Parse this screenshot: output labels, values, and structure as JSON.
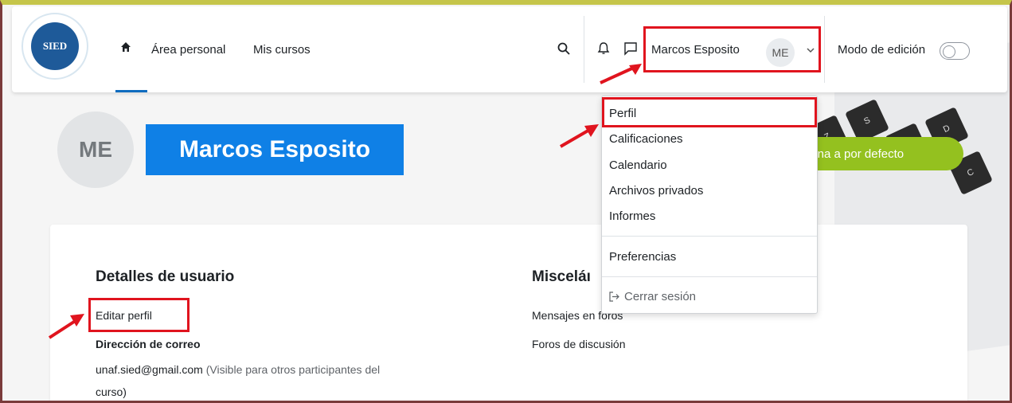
{
  "navbar": {
    "logo_text": "SIED",
    "links": [
      "Área personal",
      "Mis cursos"
    ],
    "user_name": "Marcos Esposito",
    "user_initials": "ME",
    "edit_mode_label": "Modo de edición"
  },
  "profile": {
    "initials": "ME",
    "full_name": "Marcos Esposito",
    "reset_page_button": "gina a por defecto"
  },
  "user_menu": {
    "items": [
      "Perfil",
      "Calificaciones",
      "Calendario",
      "Archivos privados",
      "Informes"
    ],
    "preferences": "Preferencias",
    "logout": "Cerrar sesión"
  },
  "details": {
    "heading": "Detalles de usuario",
    "edit_profile": "Editar perfil",
    "email_label": "Dirección de correo",
    "email_value": "unaf.sied@gmail.com",
    "email_visibility_1": "(Visible para otros participantes del",
    "email_visibility_2": "curso)"
  },
  "misc": {
    "heading": "Misceláı",
    "forum_posts": "Mensajes en foros",
    "forum_discussions": "Foros de discusión"
  },
  "colors": {
    "accent": "#0f80e6",
    "highlight": "#e0141e",
    "green_button": "#94c11f"
  }
}
